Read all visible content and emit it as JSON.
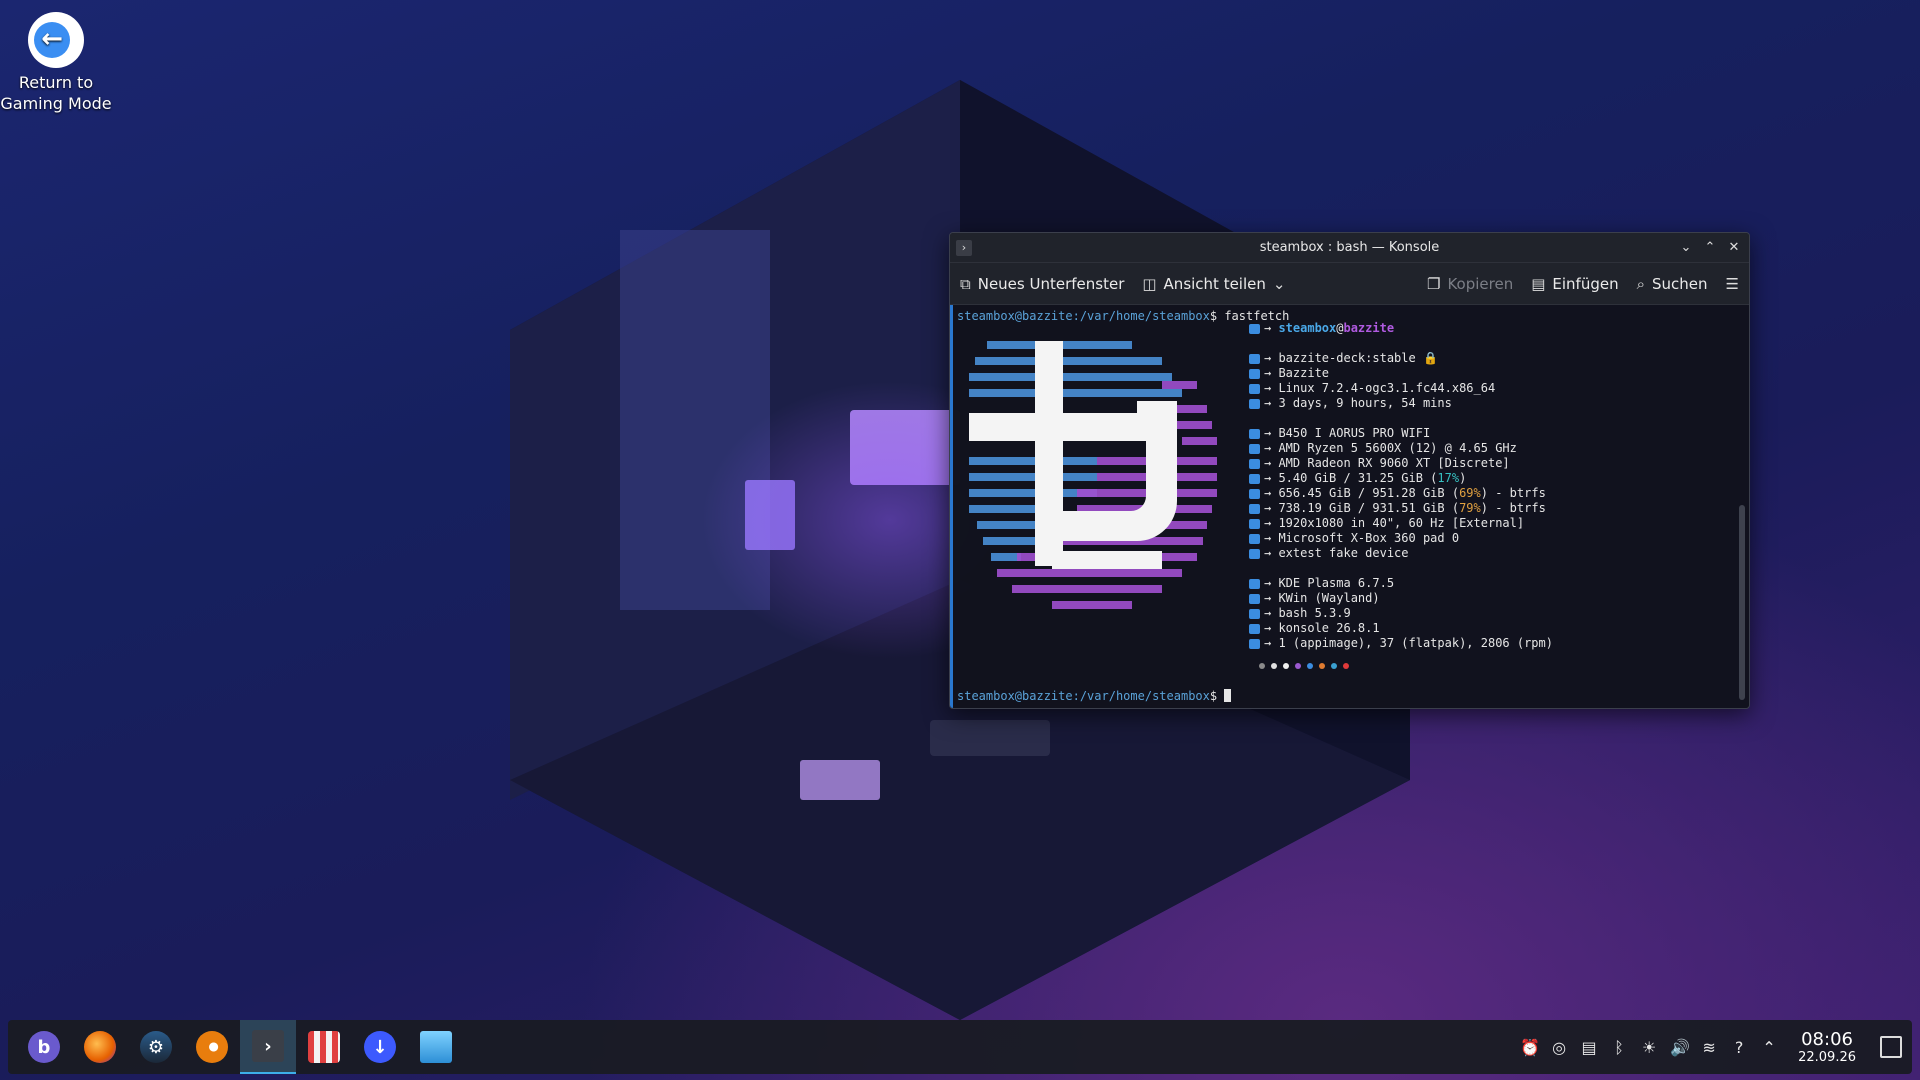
{
  "desktop": {
    "icons": [
      {
        "label_line1": "Return to",
        "label_line2": "Gaming Mode",
        "icon": "steam-back-icon"
      }
    ]
  },
  "konsole": {
    "title": "steambox : bash — Konsole",
    "toolbar": {
      "new_tab": "Neues Unterfenster",
      "split_view": "Ansicht teilen",
      "copy": "Kopieren",
      "paste": "Einfügen",
      "find": "Suchen"
    },
    "terminal": {
      "prompt_user": "steambox@bazzite",
      "prompt_path": ":/var/home/steambox",
      "prompt_symbol": "$",
      "command": " fastfetch",
      "info": {
        "user": "steambox",
        "at": "@",
        "host": "bazzite",
        "os_image": "→ bazzite-deck:stable 🔒",
        "os": "→ Bazzite",
        "kernel": "→ Linux 7.2.4-ogc3.1.fc44.x86_64",
        "uptime": "→ 3 days, 9 hours, 54 mins",
        "board": "→ B450 I AORUS PRO WIFI",
        "cpu": "→ AMD Ryzen 5 5600X (12) @ 4.65 GHz",
        "gpu": "→ AMD Radeon RX 9060 XT [Discrete]",
        "memory_prefix": "→ 5.40 GiB / 31.25 GiB (",
        "memory_pct": "17%",
        "memory_suffix": ")",
        "disk1_prefix": "→ 656.45 GiB / 951.28 GiB (",
        "disk1_pct": "69%",
        "disk1_suffix": ") - btrfs",
        "disk2_prefix": "→ 738.19 GiB / 931.51 GiB (",
        "disk2_pct": "79%",
        "disk2_suffix": ") - btrfs",
        "display": "→ 1920x1080 in 40\", 60 Hz [External]",
        "gamepad1": "→ Microsoft X-Box 360 pad 0",
        "gamepad2": "→ extest fake device",
        "de": "→ KDE Plasma 6.7.5",
        "wm": "→ KWin (Wayland)",
        "shell": "→ bash 5.3.9",
        "terminal": "→ konsole 26.8.1",
        "packages": "→ 1 (appimage), 37 (flatpak), 2806 (rpm)"
      },
      "color_dots": [
        "#8a8a8a",
        "#e0e0e0",
        "#f0f0f0",
        "#9b59d0",
        "#3b8de0",
        "#e07b30",
        "#3aa0d0",
        "#e03a3a"
      ]
    }
  },
  "taskbar": {
    "apps": [
      {
        "name": "bazzite-menu",
        "color": "#6a5acd",
        "glyph": "b"
      },
      {
        "name": "firefox",
        "color": "#e66000",
        "glyph": ""
      },
      {
        "name": "steam",
        "color": "#1b2838",
        "glyph": ""
      },
      {
        "name": "blender",
        "color": "#e87d0d",
        "glyph": ""
      },
      {
        "name": "konsole",
        "color": "#2c3a48",
        "glyph": ">"
      },
      {
        "name": "bazaar",
        "color": "#e04040",
        "glyph": ""
      },
      {
        "name": "warehouse",
        "color": "#3d5afe",
        "glyph": "↓"
      },
      {
        "name": "dolphin",
        "color": "#3daee9",
        "glyph": ""
      }
    ],
    "clock": {
      "time": "08:06",
      "date": "22.09.26"
    }
  }
}
